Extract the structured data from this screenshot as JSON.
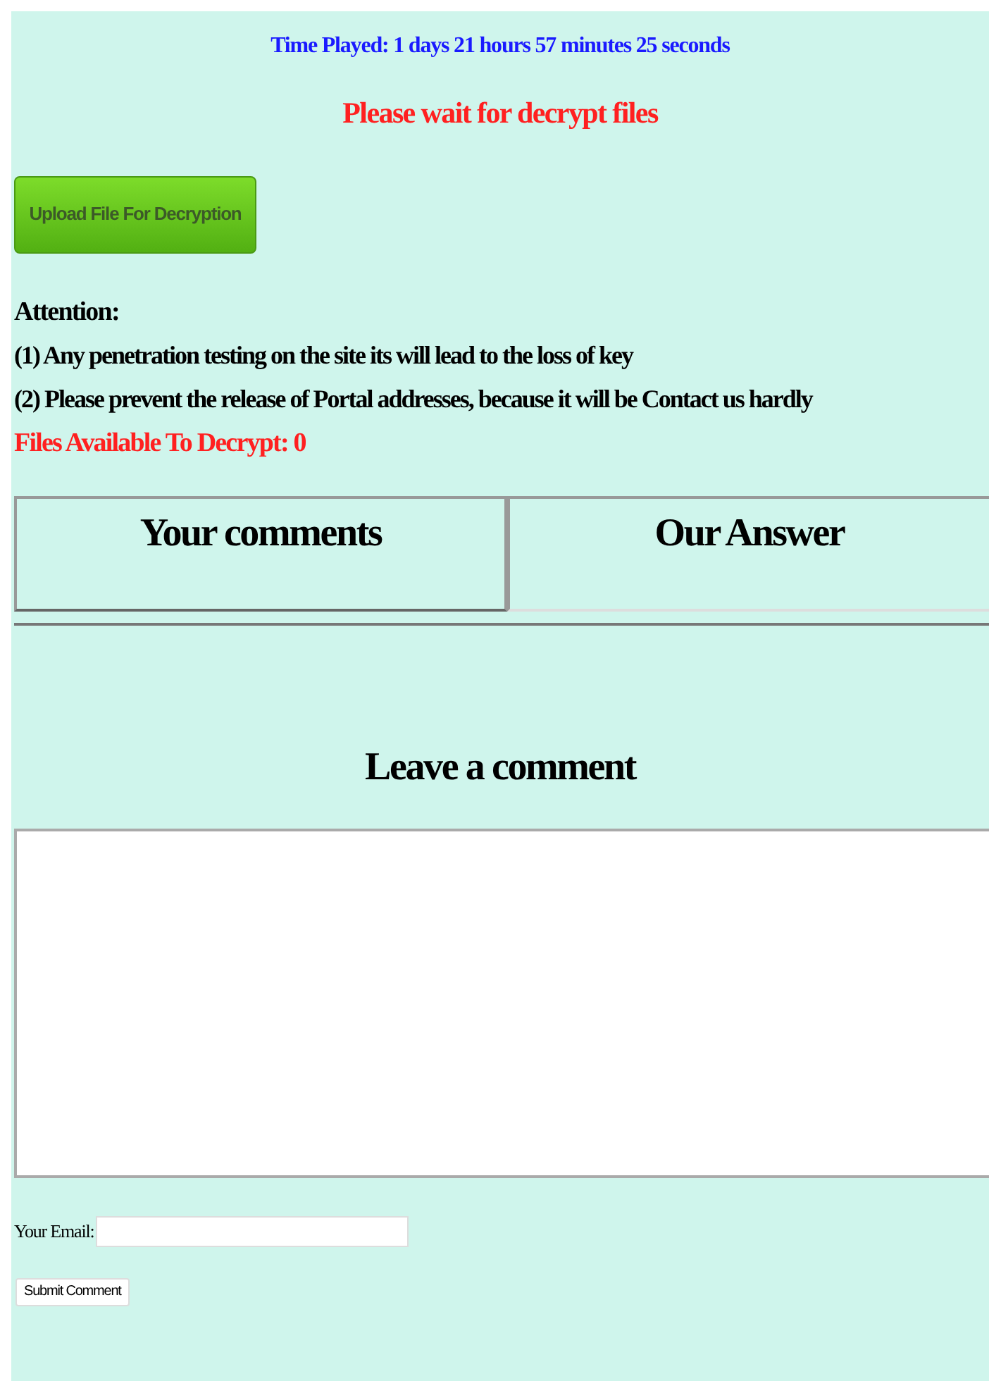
{
  "time_played": "Time Played: 1 days 21 hours 57 minutes 25 seconds",
  "status": "Please wait for decrypt files",
  "upload_button": "Upload File For Decryption",
  "attention": {
    "heading": "Attention:",
    "items": [
      "(1) Any penetration testing on the site its will lead to the loss of key",
      "(2) Please prevent the release of Portal addresses, because it will be Contact us hardly"
    ]
  },
  "files_available": "Files Available To Decrypt: 0",
  "table": {
    "columns": [
      "Your comments",
      "Our Answer"
    ]
  },
  "comment_form": {
    "heading": "Leave a comment",
    "email_label": "Your Email:",
    "submit_button": "Submit Comment"
  }
}
